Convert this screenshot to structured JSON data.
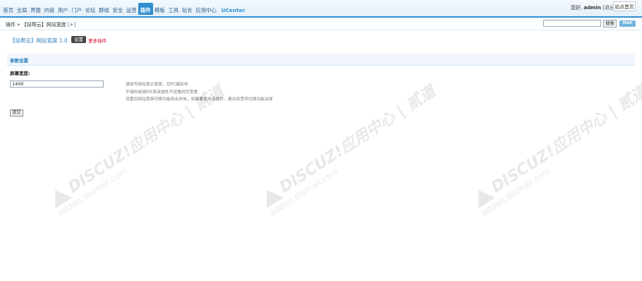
{
  "nav": {
    "items": [
      "首页",
      "全局",
      "界面",
      "内容",
      "用户",
      "门户",
      "论坛",
      "群组",
      "安全",
      "运营",
      "插件",
      "模板",
      "工具",
      "站长",
      "应用中心",
      "UCenter"
    ],
    "active_index": 10
  },
  "header": {
    "greeting_prefix": "您好,",
    "username": "admin",
    "logout": "[退出]",
    "home_button": "站点首页"
  },
  "breadcrumb": {
    "root": "插件 »",
    "current": "【站帮云】网站宽度",
    "plus": "[+]"
  },
  "search": {
    "value": "",
    "button": "搜索"
  },
  "map_button": "MAP",
  "plugin": {
    "title": "【站帮云】网站宽度 1.0",
    "settings_tab": "设置",
    "more_plugins": "更多插件"
  },
  "section": {
    "title": "参数设置",
    "field_label": "屏幕宽度:",
    "field_value": "1400",
    "help": [
      "请填写网站显示宽度，仅PC端有效",
      "不填的或填0代表该插件不设置网页宽度",
      "设置后网站宽带切换功能将会失效，如果要使用该插件，建议将宽窄切换功能关掉"
    ],
    "submit": "提交"
  },
  "watermark": {
    "line1": "DISCUZ!应用中心 | 贰道",
    "line2": "addon.dismall.com"
  },
  "colors": {
    "accent": "#2f8fcf",
    "title": "#2c7fbf",
    "more_plugins": "#d0021b"
  }
}
